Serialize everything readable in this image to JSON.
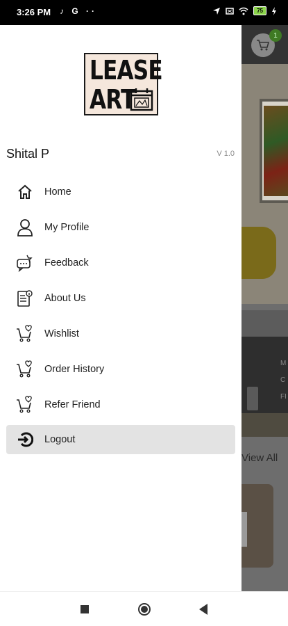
{
  "status_bar": {
    "time": "3:26 PM",
    "left_icons": "♪ G ··",
    "battery": "75"
  },
  "background": {
    "cart_badge": "1",
    "view_all": "View All",
    "card_text": "M\nC\nFI"
  },
  "drawer": {
    "logo": {
      "line1": "LEASE",
      "line2": "ART"
    },
    "user_name": "Shital P",
    "version": "V 1.0",
    "menu": [
      {
        "label": "Home",
        "icon": "home-icon"
      },
      {
        "label": "My Profile",
        "icon": "profile-icon"
      },
      {
        "label": "Feedback",
        "icon": "feedback-icon"
      },
      {
        "label": "About Us",
        "icon": "about-icon"
      },
      {
        "label": "Wishlist",
        "icon": "wishlist-icon"
      },
      {
        "label": "Order History",
        "icon": "order-history-icon"
      },
      {
        "label": "Refer Friend",
        "icon": "refer-friend-icon"
      },
      {
        "label": "Logout",
        "icon": "logout-icon",
        "active": true
      }
    ]
  },
  "colors": {
    "battery": "#8bd44a",
    "active_item_bg": "#e3e3e3",
    "cart_badge": "#3f7a24"
  }
}
